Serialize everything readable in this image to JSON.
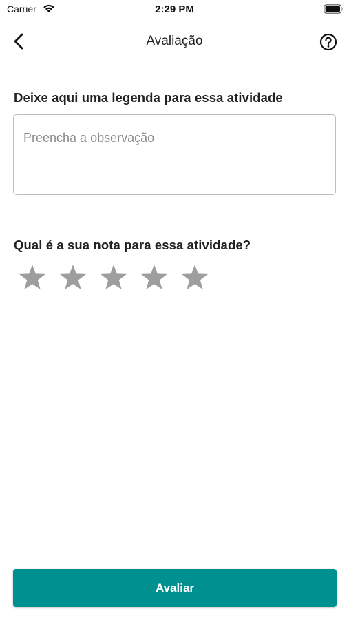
{
  "status_bar": {
    "carrier": "Carrier",
    "time": "2:29 PM",
    "wifi_icon": "wifi-icon",
    "battery_icon": "battery-full-icon"
  },
  "nav": {
    "title": "Avaliação",
    "back_icon": "chevron-left-icon",
    "help_icon": "question-circle-icon"
  },
  "caption_section": {
    "label": "Deixe aqui uma legenda para essa atividade",
    "placeholder": "Preencha a observação",
    "value": ""
  },
  "rating_section": {
    "label": "Qual é a sua nota para essa atividade?",
    "max_stars": 5,
    "selected": 0,
    "star_icon": "star-icon",
    "star_color": "#9e9e9e"
  },
  "submit": {
    "label": "Avaliar",
    "color": "#009090"
  }
}
